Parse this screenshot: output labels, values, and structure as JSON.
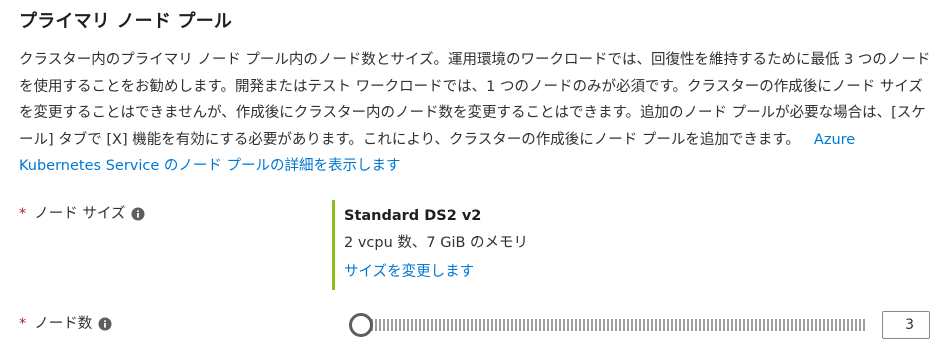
{
  "section": {
    "title": "プライマリ ノード プール",
    "description": "クラスター内のプライマリ ノード プール内のノード数とサイズ。運用環境のワークロードでは、回復性を維持するために最低 3 つのノードを使用することをお勧めします。開発またはテスト ワークロードでは、1 つのノードのみが必須です。クラスターの作成後にノード サイズを変更することはできませんが、作成後にクラスター内のノード数を変更することはできます。追加のノード プールが必要な場合は、[スケール] タブで [X] 機能を有効にする必要があります。これにより、クラスターの作成後にノード プールを追加できます。",
    "link_text": "Azure Kubernetes Service のノード プールの詳細を表示します"
  },
  "node_size": {
    "required_marker": "*",
    "label": "ノード サイズ",
    "info_icon": "info-icon",
    "selected_name": "Standard DS2 v2",
    "specs": "2 vcpu 数、7 GiB のメモリ",
    "change_link": "サイズを変更します",
    "accent_color": "#8cbd18"
  },
  "node_count": {
    "required_marker": "*",
    "label": "ノード数",
    "info_icon": "info-icon",
    "value": "3",
    "slider_fraction": 0.0
  },
  "colors": {
    "link": "#0078d4",
    "required": "#a4262c",
    "text": "#323130"
  }
}
